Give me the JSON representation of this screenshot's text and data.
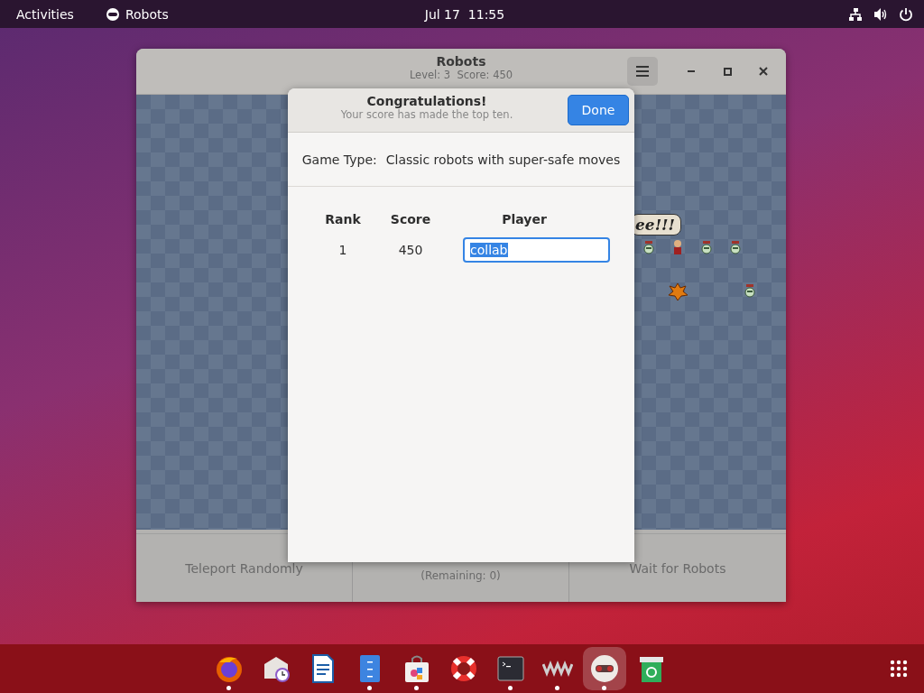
{
  "top_bar": {
    "activities": "Activities",
    "app_name": "Robots",
    "clock": "Jul 17  11:55"
  },
  "window": {
    "title": "Robots",
    "subtitle": "Level: 3  Score: 450",
    "speech_bubble": "ee!!!",
    "buttons": [
      {
        "label": "Teleport Randomly"
      },
      {
        "detail": "(Remaining: 0)"
      },
      {
        "label": "Wait for Robots"
      }
    ]
  },
  "dialog": {
    "title": "Congratulations!",
    "subtitle": "Your score has made the top ten.",
    "done_button": "Done",
    "game_type_label": "Game Type:",
    "game_type": "Classic robots with super-safe moves",
    "columns": [
      "Rank",
      "Score",
      "Player"
    ],
    "rows": [
      {
        "rank": "1",
        "score": "450",
        "player": "collab",
        "text_selected": true
      }
    ]
  },
  "dock": [
    {
      "kind": "browser",
      "running": true,
      "selected": false
    },
    {
      "kind": "mail",
      "running": false,
      "selected": false
    },
    {
      "kind": "document",
      "running": false,
      "selected": false
    },
    {
      "kind": "files",
      "running": true,
      "selected": false
    },
    {
      "kind": "store",
      "running": true,
      "selected": false
    },
    {
      "kind": "help",
      "running": false,
      "selected": false
    },
    {
      "kind": "terminal",
      "running": true,
      "selected": false
    },
    {
      "kind": "vm",
      "running": true,
      "selected": false
    },
    {
      "kind": "robots",
      "running": true,
      "selected": true
    },
    {
      "kind": "trash",
      "running": false,
      "selected": false
    }
  ]
}
